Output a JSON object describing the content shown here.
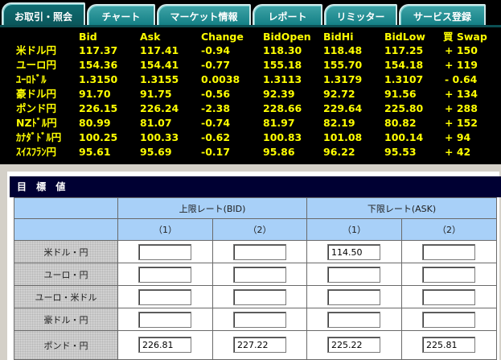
{
  "tabs": [
    {
      "label": "お取引・照会",
      "active": true
    },
    {
      "label": "チャート",
      "active": false
    },
    {
      "label": "マーケット情報",
      "active": false
    },
    {
      "label": "レポート",
      "active": false
    },
    {
      "label": "リミッター",
      "active": false
    },
    {
      "label": "サービス登録",
      "active": false
    }
  ],
  "rates": {
    "headers": [
      "Bid",
      "Ask",
      "Change",
      "BidOpen",
      "BidHi",
      "BidLow",
      "買 Swap"
    ],
    "rows": [
      {
        "pair": "米ドル円",
        "bid": "117.37",
        "ask": "117.41",
        "change": "-0.94",
        "bidopen": "118.30",
        "bidhi": "118.48",
        "bidlow": "117.25",
        "swap": "+ 150"
      },
      {
        "pair": "ユーロ円",
        "bid": "154.36",
        "ask": "154.41",
        "change": "-0.77",
        "bidopen": "155.18",
        "bidhi": "155.70",
        "bidlow": "154.18",
        "swap": "+ 119"
      },
      {
        "pair": "ﾕｰﾛﾄﾞﾙ",
        "bid": "1.3150",
        "ask": "1.3155",
        "change": "0.0038",
        "bidopen": "1.3113",
        "bidhi": "1.3179",
        "bidlow": "1.3107",
        "swap": "- 0.64"
      },
      {
        "pair": "豪ドル円",
        "bid": "91.70",
        "ask": "91.75",
        "change": "-0.56",
        "bidopen": "92.39",
        "bidhi": "92.72",
        "bidlow": "91.56",
        "swap": "+ 134"
      },
      {
        "pair": "ポンド円",
        "bid": "226.15",
        "ask": "226.24",
        "change": "-2.38",
        "bidopen": "228.66",
        "bidhi": "229.64",
        "bidlow": "225.80",
        "swap": "+ 288"
      },
      {
        "pair": "NZﾄﾞﾙ円",
        "bid": "80.99",
        "ask": "81.07",
        "change": "-0.74",
        "bidopen": "81.97",
        "bidhi": "82.19",
        "bidlow": "80.82",
        "swap": "+ 152"
      },
      {
        "pair": "ｶﾅﾀﾞﾄﾞﾙ円",
        "bid": "100.25",
        "ask": "100.33",
        "change": "-0.62",
        "bidopen": "100.83",
        "bidhi": "101.08",
        "bidlow": "100.14",
        "swap": "+ 94"
      },
      {
        "pair": "ｽｲｽﾌﾗﾝ円",
        "bid": "95.61",
        "ask": "95.69",
        "change": "-0.17",
        "bidopen": "95.86",
        "bidhi": "96.22",
        "bidlow": "95.53",
        "swap": "+ 42"
      }
    ]
  },
  "target": {
    "title": "目 標 値",
    "upper_header": "上限レート(BID)",
    "lower_header": "下限レート(ASK)",
    "sub_headers": [
      "（1）",
      "（2）",
      "（1）",
      "（2）"
    ],
    "rows": [
      {
        "pair": "米ドル・円",
        "values": [
          "",
          "",
          "114.50",
          ""
        ]
      },
      {
        "pair": "ユーロ・円",
        "values": [
          "",
          "",
          "",
          ""
        ]
      },
      {
        "pair": "ユーロ・米ドル",
        "values": [
          "",
          "",
          "",
          ""
        ]
      },
      {
        "pair": "豪ドル・円",
        "values": [
          "",
          "",
          "",
          ""
        ]
      },
      {
        "pair": "ポンド・円",
        "values": [
          "226.81",
          "227.22",
          "225.22",
          "225.81"
        ]
      }
    ]
  },
  "colors": {
    "rate_text": "#ffff00",
    "tab": "#1a8a8f",
    "header_blue": "#a8d0f8",
    "target_bar": "#000033"
  }
}
